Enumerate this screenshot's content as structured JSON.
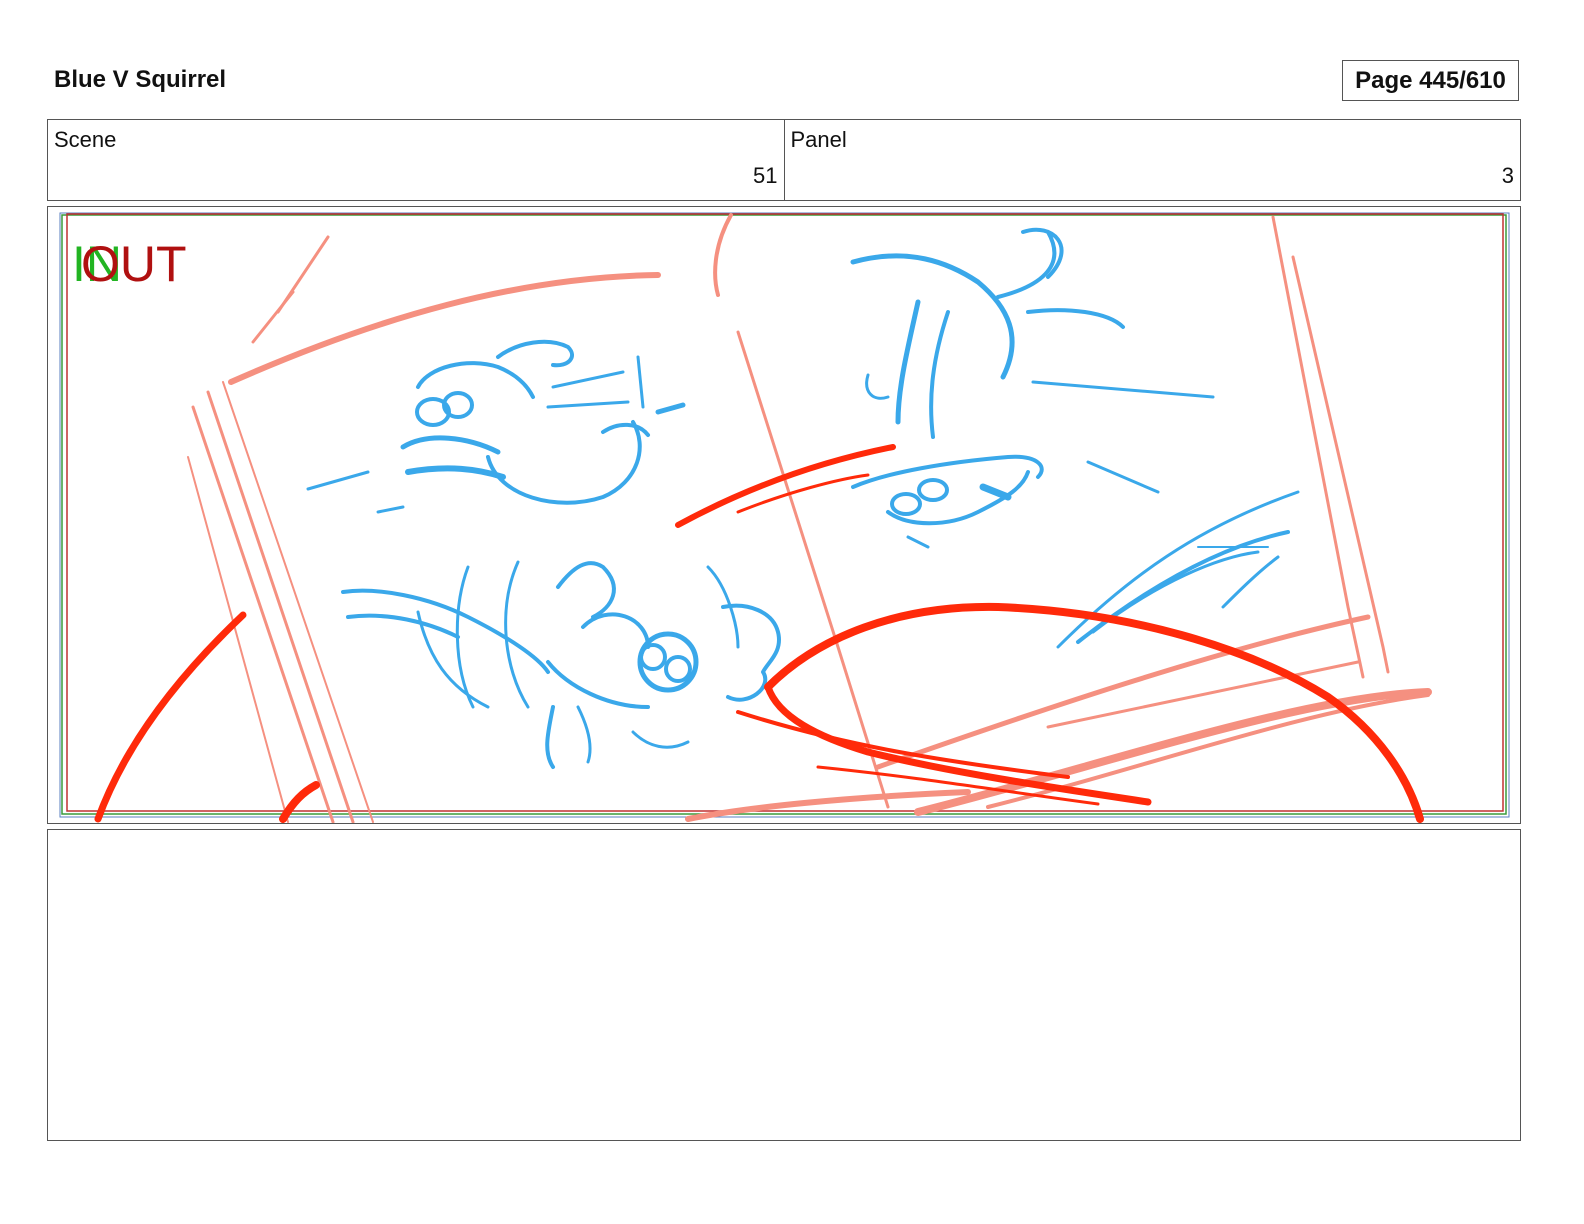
{
  "header": {
    "title": "Blue V Squirrel",
    "page": "Page 445/610"
  },
  "info": {
    "scene_label": "Scene",
    "scene_value": "51",
    "panel_label": "Panel",
    "panel_value": "3"
  },
  "frame": {
    "in_mark": "IN",
    "out_mark": "OUT",
    "colors": {
      "in": "#22b422",
      "out": "#b01010",
      "sketch_blue": "#3aa8ea",
      "sketch_red": "#ff2a0a",
      "sketch_pink": "#f59080",
      "guide_red": "#c03030",
      "guide_green": "#3a9a3a",
      "guide_blue": "#5a7fc0"
    }
  },
  "notes": {
    "text": ""
  }
}
